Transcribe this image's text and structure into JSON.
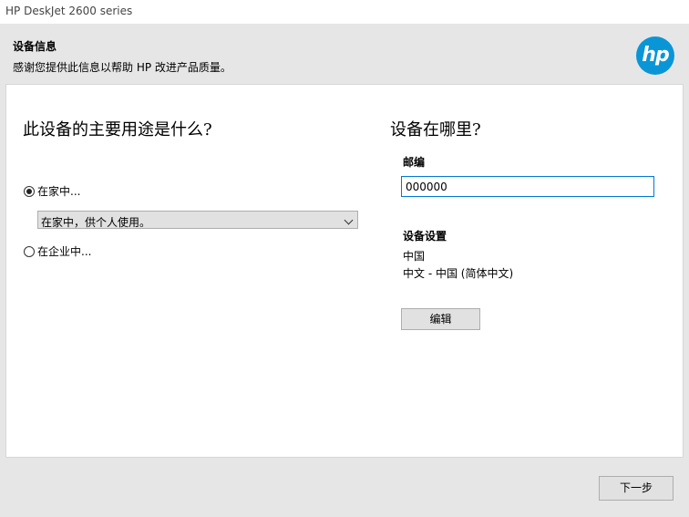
{
  "window": {
    "title": "HP DeskJet 2600 series"
  },
  "header": {
    "title": "设备信息",
    "subtitle": "感谢您提供此信息以帮助 HP 改进产品质量。",
    "logo_text": "hp",
    "logo_color": "#0a96d6"
  },
  "left": {
    "question": "此设备的主要用途是什么?",
    "options": [
      {
        "label": "在家中...",
        "selected": true
      },
      {
        "label": "在企业中...",
        "selected": false
      }
    ],
    "home_use_select": {
      "value": "在家中，供个人使用。"
    }
  },
  "right": {
    "question": "设备在哪里?",
    "zip_label": "邮编",
    "zip_value": "000000",
    "settings_label": "设备设置",
    "country": "中国",
    "language": "中文 - 中国 (简体中文)",
    "edit_button": "编辑"
  },
  "footer": {
    "next_button": "下一步"
  }
}
